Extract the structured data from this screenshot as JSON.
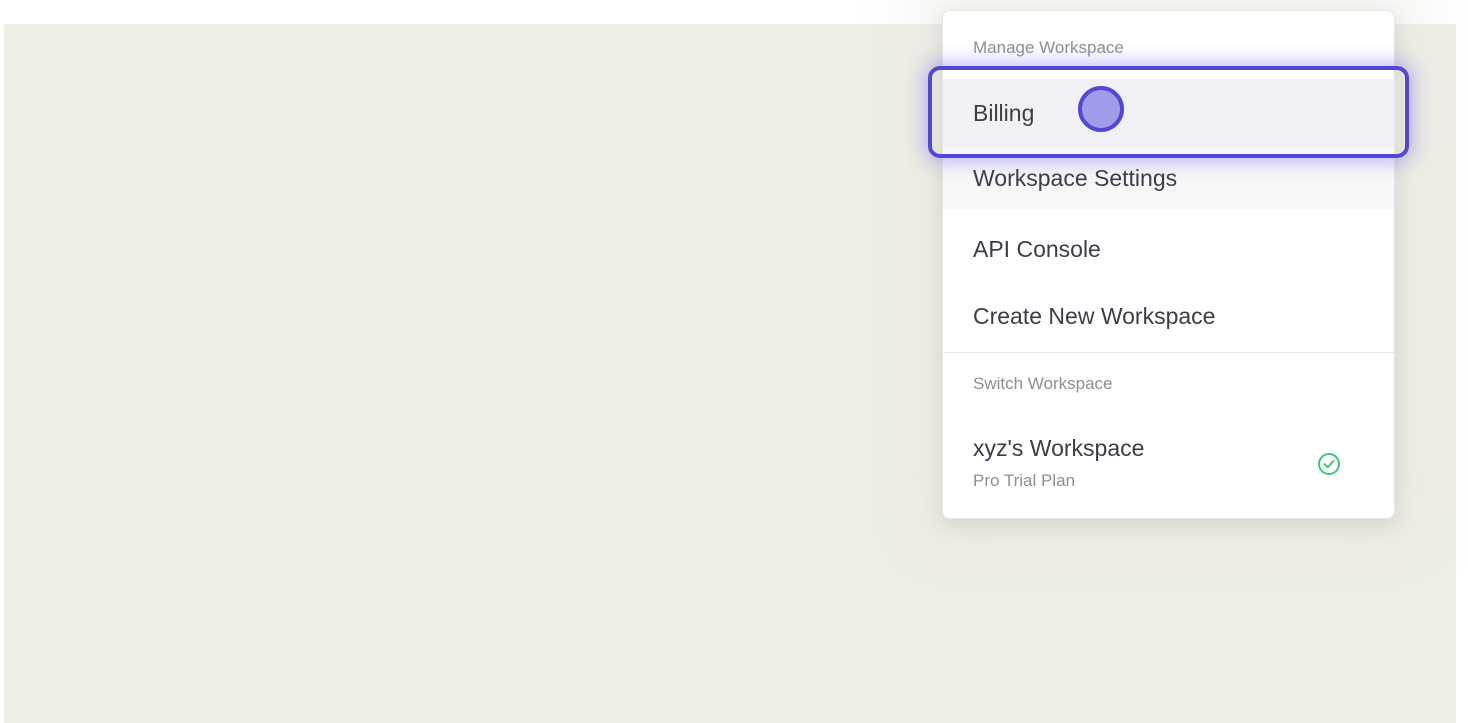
{
  "menu": {
    "manage_section_label": "Manage Workspace",
    "items": [
      {
        "label": "Billing"
      },
      {
        "label": "Workspace Settings"
      },
      {
        "label": "API Console"
      },
      {
        "label": "Create New Workspace"
      }
    ],
    "switch_section_label": "Switch Workspace",
    "workspaces": [
      {
        "name": "xyz's Workspace",
        "plan": "Pro Trial Plan",
        "active": true,
        "status_icon": "check-circle-icon"
      }
    ]
  },
  "colors": {
    "background": "#efeee7",
    "highlight": "#5147d8",
    "active_check": "#3cc77a"
  }
}
